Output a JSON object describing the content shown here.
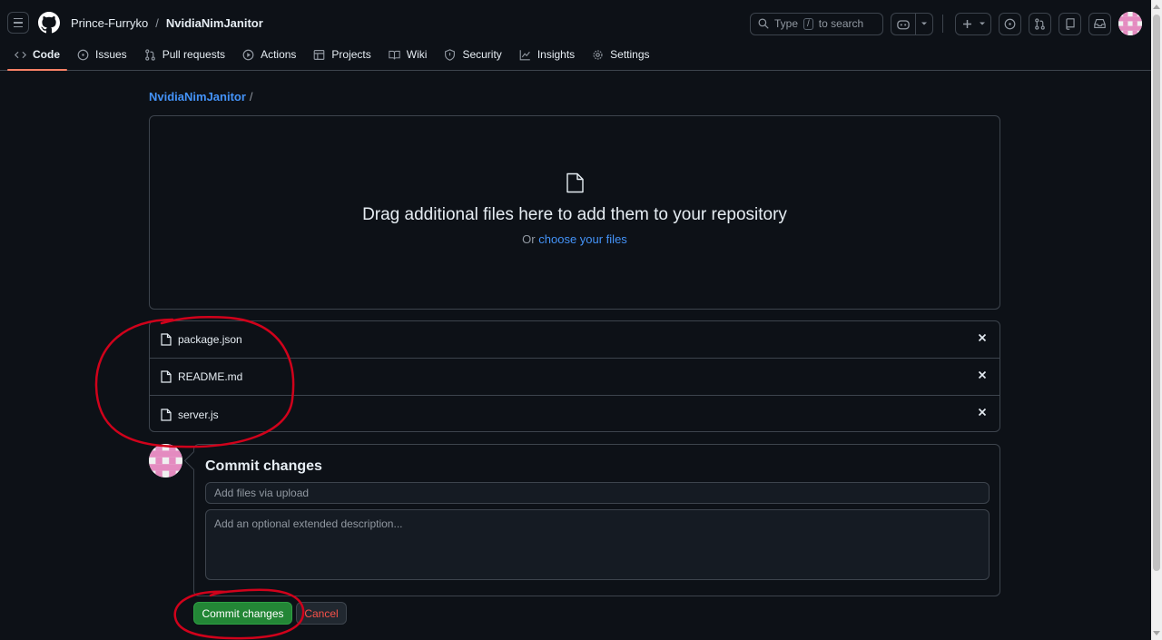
{
  "header": {
    "owner": "Prince-Furryko",
    "separator": "/",
    "repo": "NvidiaNimJanitor",
    "search_label": "Type",
    "search_key": "/",
    "search_suffix": "to search"
  },
  "tabs": [
    {
      "label": "Code",
      "icon": "code-icon",
      "active": true
    },
    {
      "label": "Issues",
      "icon": "issue-icon"
    },
    {
      "label": "Pull requests",
      "icon": "pull-request-icon"
    },
    {
      "label": "Actions",
      "icon": "play-icon"
    },
    {
      "label": "Projects",
      "icon": "table-icon"
    },
    {
      "label": "Wiki",
      "icon": "book-icon"
    },
    {
      "label": "Security",
      "icon": "shield-icon"
    },
    {
      "label": "Insights",
      "icon": "graph-icon"
    },
    {
      "label": "Settings",
      "icon": "gear-icon"
    }
  ],
  "breadcrumb": {
    "repo": "NvidiaNimJanitor",
    "separator": "/"
  },
  "dropzone": {
    "title": "Drag additional files here to add them to your repository",
    "prefix": "Or",
    "link": "choose your files"
  },
  "files": [
    {
      "name": "package.json"
    },
    {
      "name": "README.md"
    },
    {
      "name": "server.js"
    }
  ],
  "commit": {
    "title": "Commit changes",
    "summary_placeholder": "Add files via upload",
    "description_placeholder": "Add an optional extended description...",
    "commit_button": "Commit changes",
    "cancel_button": "Cancel"
  },
  "colors": {
    "background": "#0d1117",
    "border": "#3d444d",
    "link": "#4493f8",
    "primary_button": "#238636",
    "danger": "#f85149",
    "annotation": "#d0021b"
  }
}
